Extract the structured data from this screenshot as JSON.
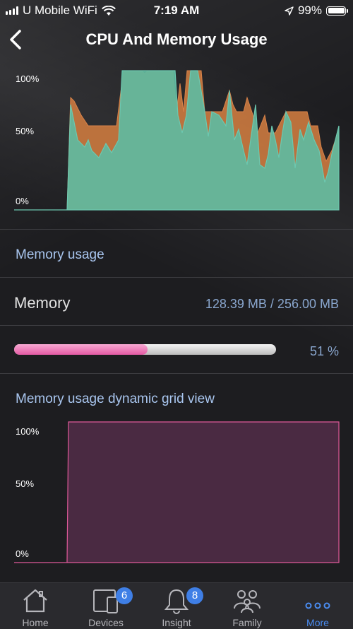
{
  "status_bar": {
    "carrier": "U Mobile WiFi",
    "time": "7:19 AM",
    "battery": "99%"
  },
  "header": {
    "title": "CPU And Memory Usage"
  },
  "cpu_chart": {
    "ticks": [
      "100%",
      "50%",
      "0%"
    ],
    "colors": {
      "series_a": "#d9834a",
      "series_b": "#6cc8b0"
    }
  },
  "memory_section": {
    "title": "Memory usage",
    "label": "Memory",
    "value": "128.39 MB / 256.00 MB",
    "percent_text": "51 %",
    "percent": 51,
    "bar_color": "#e45aa4"
  },
  "grid_section": {
    "title": "Memory usage dynamic grid view",
    "ticks": [
      "100%",
      "50%",
      "0%"
    ],
    "line_color": "#e05a9a"
  },
  "tabbar": {
    "items": [
      {
        "label": "Home",
        "icon": "home-icon"
      },
      {
        "label": "Devices",
        "icon": "devices-icon",
        "badge": "6"
      },
      {
        "label": "Insight",
        "icon": "bell-icon",
        "badge": "8"
      },
      {
        "label": "Family",
        "icon": "family-icon"
      },
      {
        "label": "More",
        "icon": "more-icon",
        "active": true
      }
    ],
    "active_color": "#4a8cf1"
  }
}
